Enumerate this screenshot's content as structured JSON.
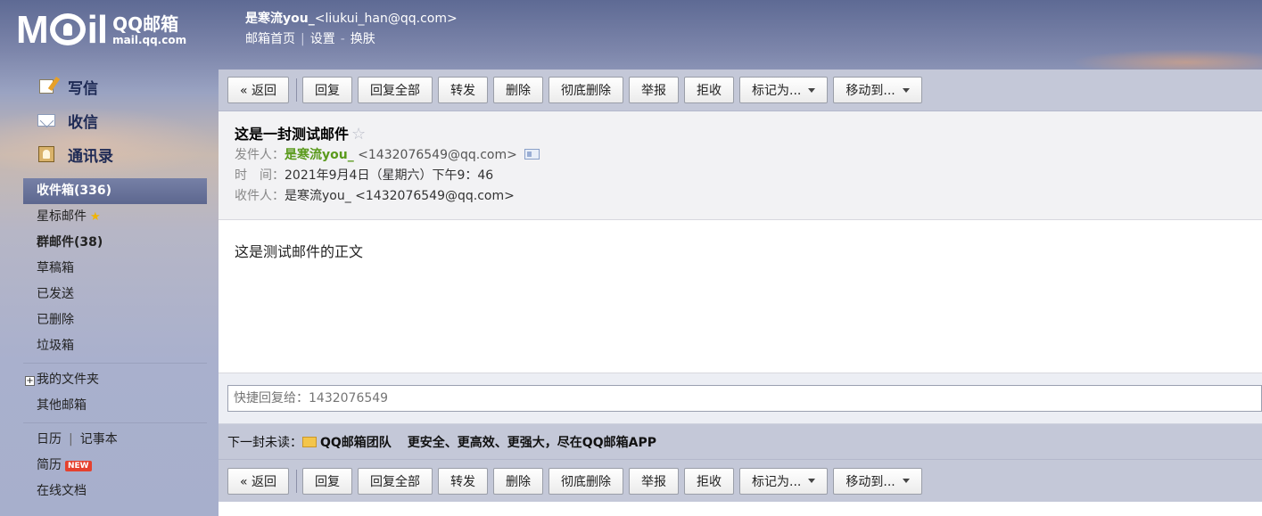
{
  "header": {
    "logo_text": "MOil",
    "logo_cn": "QQ邮箱",
    "logo_en": "mail.qq.com",
    "user_name": "是寒流you_",
    "user_email": "<liukui_han@qq.com>",
    "links": [
      "邮箱首页",
      "设置",
      "换肤"
    ]
  },
  "sidebar": {
    "primary": [
      {
        "label": "写信",
        "icon": "write-icon"
      },
      {
        "label": "收信",
        "icon": "inbox-icon"
      },
      {
        "label": "通讯录",
        "icon": "contacts-icon"
      }
    ],
    "folders": [
      {
        "label": "收件箱(336)",
        "active": true,
        "bold": true
      },
      {
        "label": "星标邮件",
        "star": true
      },
      {
        "label": "群邮件(38)",
        "bold": true
      },
      {
        "label": "草稿箱"
      },
      {
        "label": "已发送"
      },
      {
        "label": "已删除"
      },
      {
        "label": "垃圾箱"
      }
    ],
    "my_folders": "我的文件夹",
    "other_mail": "其他邮箱",
    "calendar": "日历",
    "notes": "记事本",
    "resume": "简历",
    "new_badge": "NEW",
    "online_docs": "在线文档"
  },
  "toolbar": {
    "back": "« 返回",
    "reply": "回复",
    "reply_all": "回复全部",
    "forward": "转发",
    "delete": "删除",
    "delete_perm": "彻底删除",
    "report": "举报",
    "reject": "拒收",
    "mark_as": "标记为...",
    "move_to": "移动到..."
  },
  "mail": {
    "subject": "这是一封测试邮件",
    "star_glyph": "☆",
    "from_label": "发件人：",
    "from_name": "是寒流you_",
    "from_addr": "<1432076549@qq.com>",
    "time_label": "时　间：",
    "time_value": "2021年9月4日（星期六）下午9：46",
    "to_label": "收件人：",
    "to_value": "是寒流you_ <1432076549@qq.com>",
    "body": "这是测试邮件的正文"
  },
  "quick_reply": {
    "placeholder": "快捷回复给：1432076549"
  },
  "next_unread": {
    "label": "下一封未读：",
    "from": "QQ邮箱团队",
    "subject": "更安全、更高效、更强大，尽在QQ邮箱APP"
  }
}
